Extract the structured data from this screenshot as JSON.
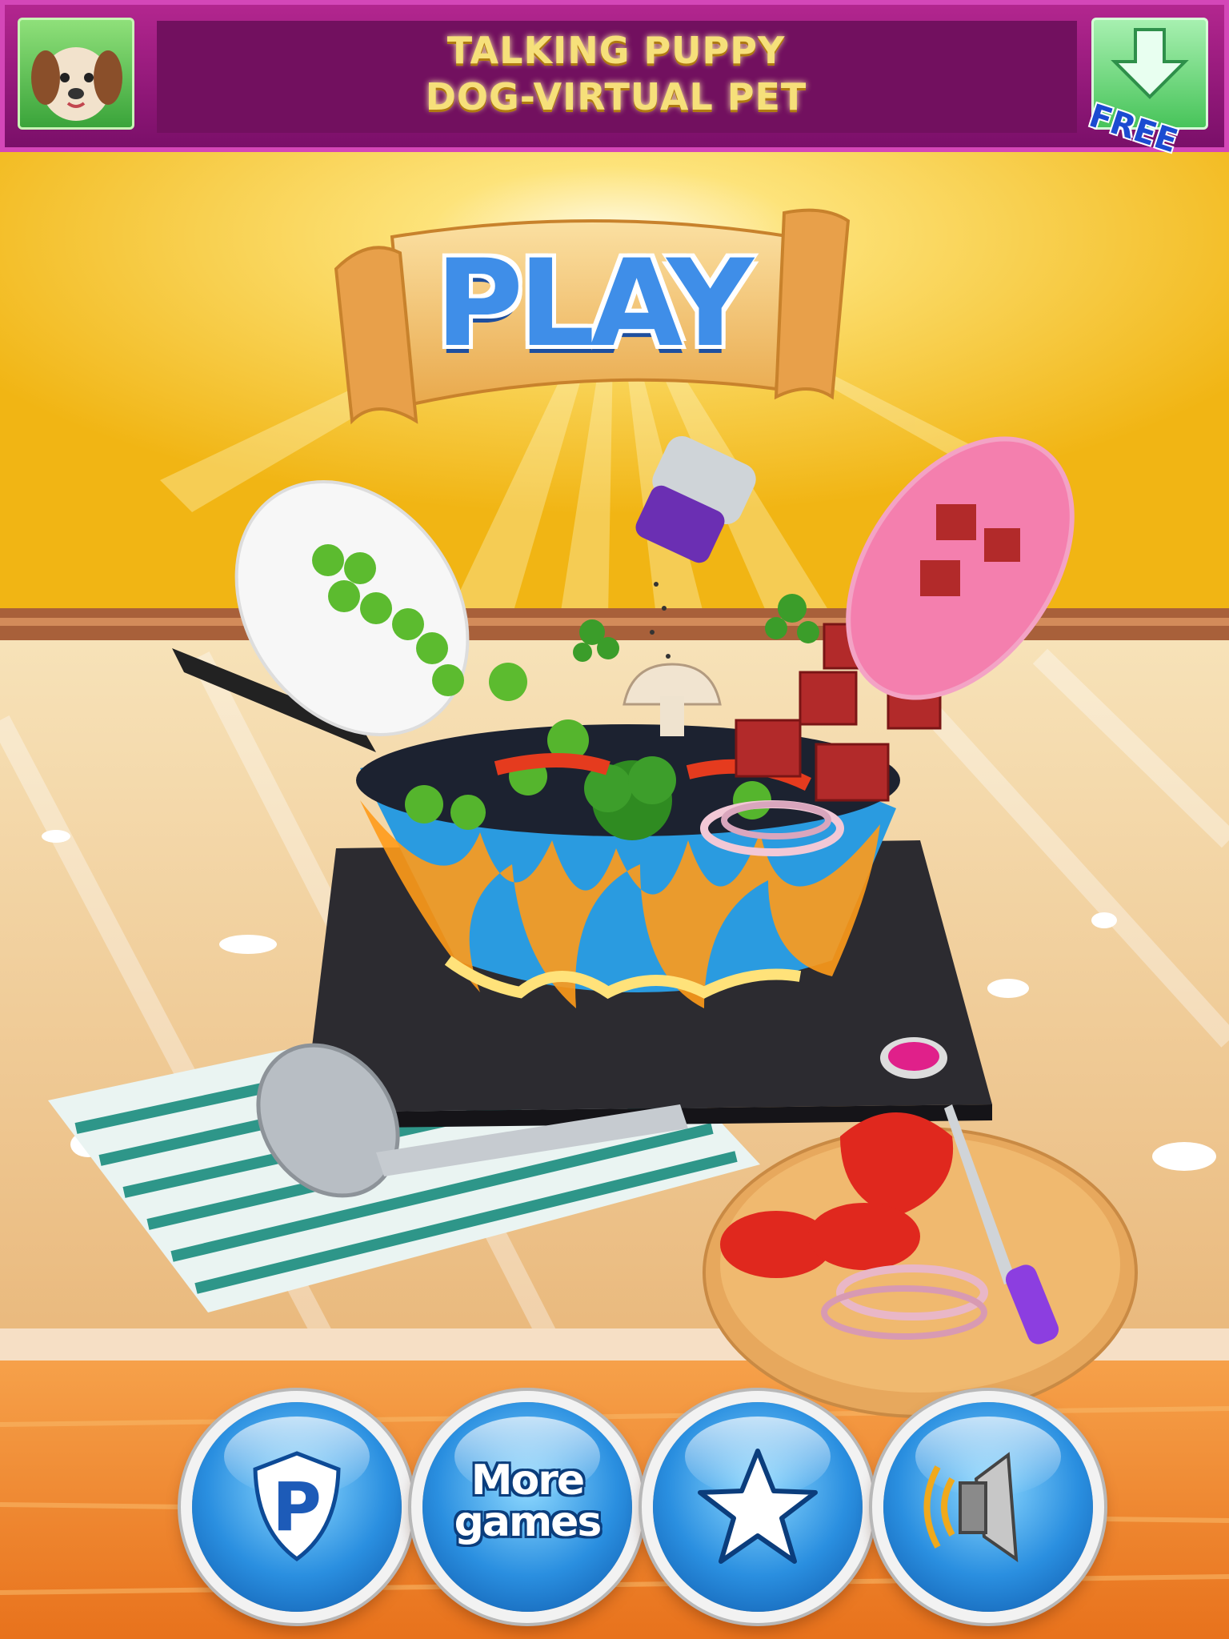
{
  "ad": {
    "title_line1": "TALKING PUPPY",
    "title_line2": "DOG-VIRTUAL PET",
    "badge": "FREE",
    "icon": "puppy-icon",
    "download_icon": "download-arrow-icon"
  },
  "main": {
    "play_label": "PLAY"
  },
  "bottom_bar": {
    "privacy": {
      "icon": "privacy-shield-icon",
      "letter": "P"
    },
    "more_games": {
      "line1": "More",
      "line2": "games"
    },
    "rate": {
      "icon": "star-icon"
    },
    "sound": {
      "icon": "speaker-icon"
    }
  },
  "colors": {
    "wall": "#f4c21c",
    "counter": "#f0c98a",
    "bottom_wood": "#f07a1e",
    "ad_bg": "#8e1479",
    "button_blue": "#2a8fe0",
    "play_text": "#3f8ee8"
  }
}
